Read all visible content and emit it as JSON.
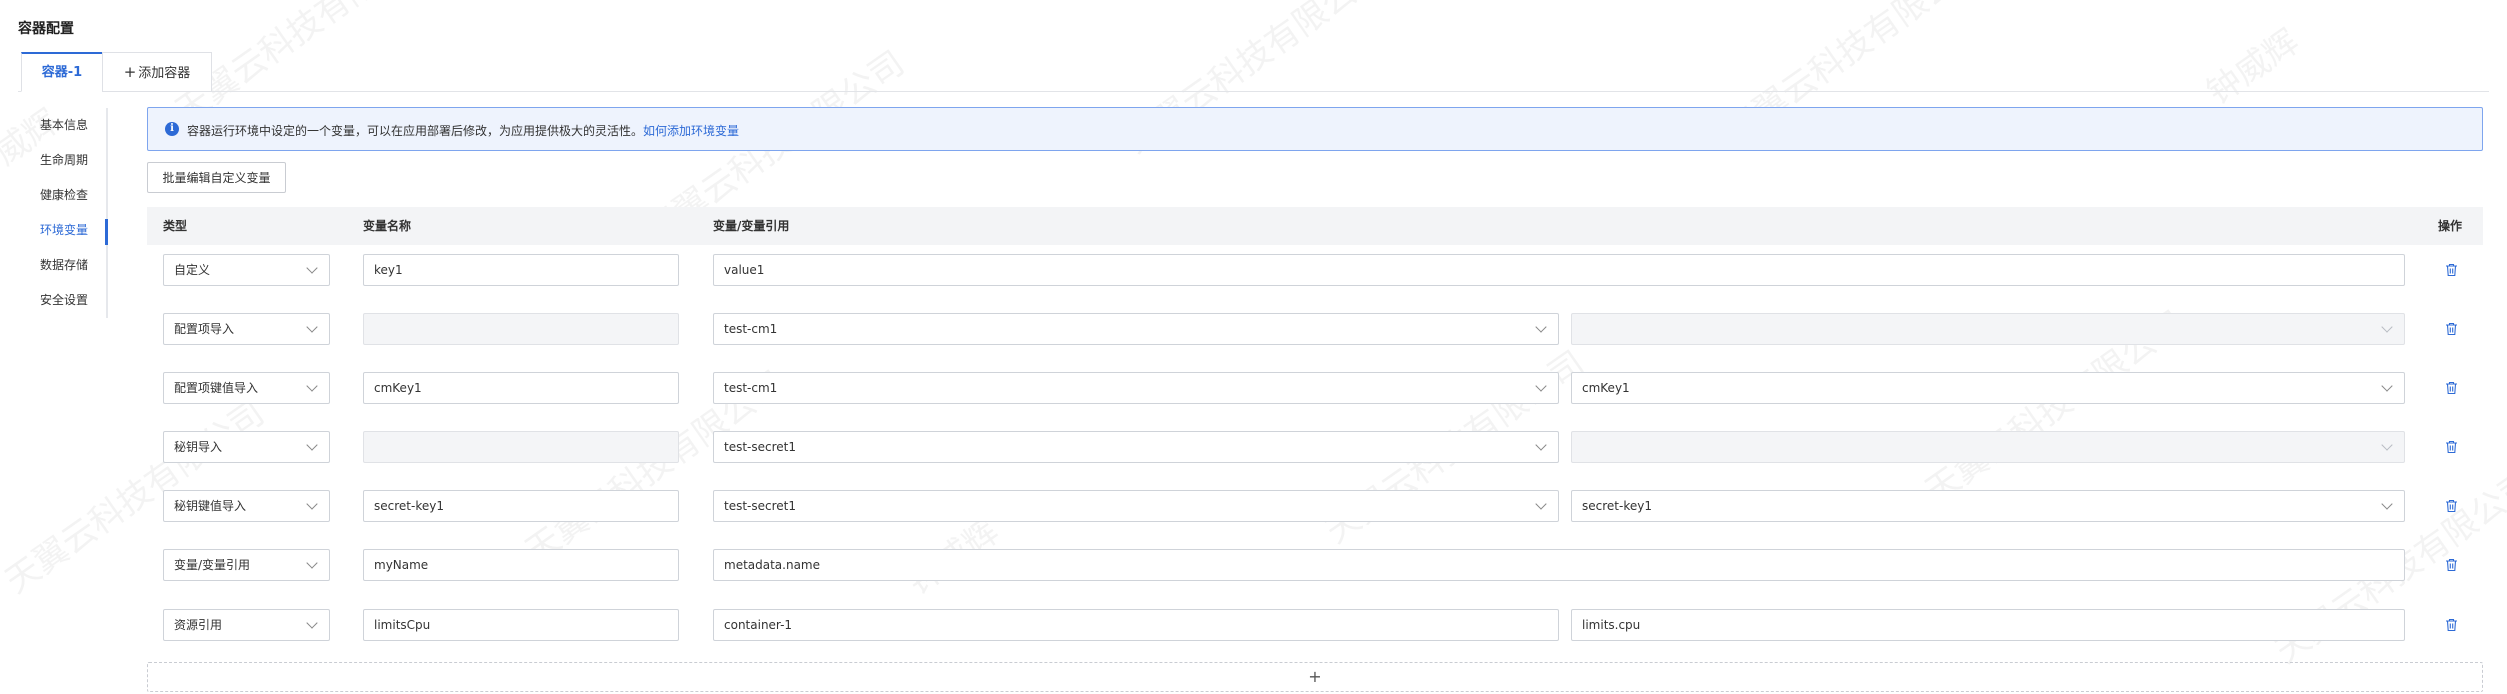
{
  "page_title": "容器配置",
  "tabs": {
    "active": "容器-1",
    "add_symbol": "+",
    "add_label": "添加容器"
  },
  "side_nav": [
    {
      "label": "基本信息",
      "active": false
    },
    {
      "label": "生命周期",
      "active": false
    },
    {
      "label": "健康检查",
      "active": false
    },
    {
      "label": "环境变量",
      "active": true
    },
    {
      "label": "数据存储",
      "active": false
    },
    {
      "label": "安全设置",
      "active": false
    }
  ],
  "info": {
    "icon": "info-icon",
    "text": "容器运行环境中设定的一个变量，可以在应用部署后修改，为应用提供极大的灵活性。",
    "link": "如何添加环境变量"
  },
  "batch_button": "批量编辑自定义变量",
  "table": {
    "headers": {
      "type": "类型",
      "name": "变量名称",
      "value": "变量/变量引用",
      "action": "操作"
    },
    "rows": [
      {
        "type": "自定义",
        "name": "key1",
        "value": "value1"
      },
      {
        "type": "配置项导入",
        "name": "",
        "value": "test-cm1",
        "value2": ""
      },
      {
        "type": "配置项键值导入",
        "name": "cmKey1",
        "value": "test-cm1",
        "value2": "cmKey1"
      },
      {
        "type": "秘钥导入",
        "name": "",
        "value": "test-secret1",
        "value2": ""
      },
      {
        "type": "秘钥键值导入",
        "name": "secret-key1",
        "value": "test-secret1",
        "value2": "secret-key1"
      },
      {
        "type": "变量/变量引用",
        "name": "myName",
        "value": "metadata.name"
      },
      {
        "type": "资源引用",
        "name": "limitsCpu",
        "value": "container-1",
        "value2": "limits.cpu"
      }
    ]
  },
  "add_row_symbol": "+",
  "watermark": {
    "company": "天翼云科技有限公司",
    "person": "钟威辉"
  },
  "colors": {
    "accent": "#2d6ad6",
    "info_bg": "#eef3fd",
    "info_border": "#7ea5ee",
    "table_head_bg": "#f3f4f6",
    "trash": "#2d6ad6"
  }
}
